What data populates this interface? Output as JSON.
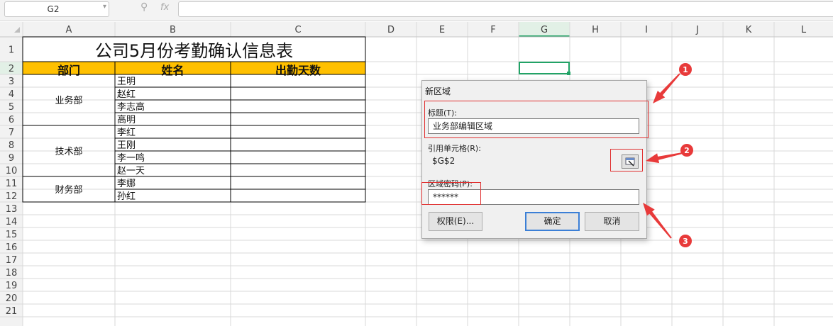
{
  "toolbar": {
    "cell_ref": "G2",
    "fx_label": "fx",
    "formula_value": ""
  },
  "columns": [
    "A",
    "B",
    "C",
    "D",
    "E",
    "F",
    "G",
    "H",
    "I",
    "J",
    "K",
    "L"
  ],
  "rows": [
    "1",
    "2",
    "3",
    "4",
    "5",
    "6",
    "7",
    "8",
    "9",
    "10",
    "11",
    "12",
    "13",
    "14",
    "15",
    "16",
    "17",
    "18",
    "19",
    "20",
    "21"
  ],
  "sheet": {
    "title": "公司5月份考勤确认信息表",
    "headers": [
      "部门",
      "姓名",
      "出勤天数"
    ],
    "header_fill": "#FFC000",
    "departments": [
      {
        "name": "业务部",
        "members": [
          "王明",
          "赵红",
          "李志高",
          "高明"
        ]
      },
      {
        "name": "技术部",
        "members": [
          "李红",
          "王刚",
          "李一鸣",
          "赵一天"
        ]
      },
      {
        "name": "财务部",
        "members": [
          "李娜",
          "孙红"
        ]
      }
    ]
  },
  "dialog": {
    "title": "新区域",
    "title_label": "标题(T):",
    "title_value": "业务部编辑区域",
    "ref_label": "引用单元格(R):",
    "ref_value": "$G$2",
    "password_label": "区域密码(P):",
    "password_value": "******",
    "permissions_button": "权限(E)...",
    "ok_button": "确定",
    "cancel_button": "取消"
  },
  "annotations": {
    "color": "#e83a3a",
    "markers": [
      "1",
      "2",
      "3"
    ]
  },
  "colors": {
    "selection": "#21a366",
    "active_header": "#e2f0e6",
    "grid_line": "#d9d9d9"
  }
}
